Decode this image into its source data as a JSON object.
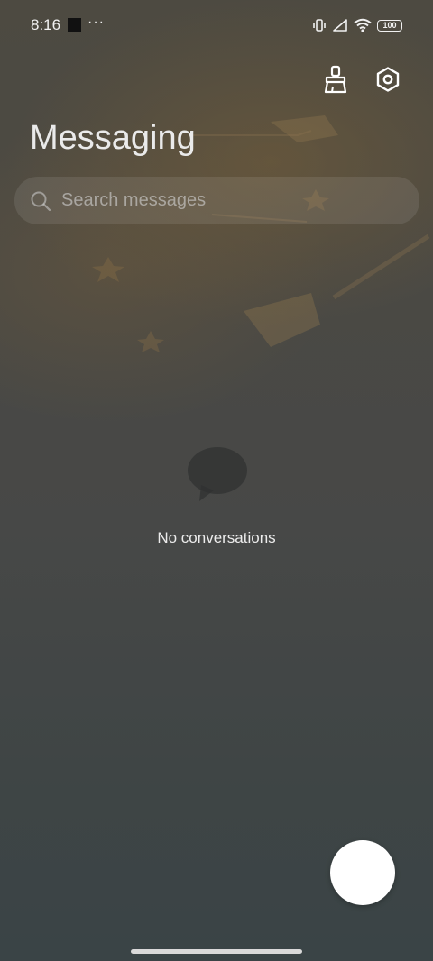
{
  "status_bar": {
    "time": "8:16",
    "more_indicator": "···",
    "battery_level": "100",
    "icons": [
      "notification-square-icon",
      "vibrate-icon",
      "cellular-signal-icon",
      "wifi-icon",
      "battery-icon"
    ]
  },
  "header": {
    "title": "Messaging",
    "actions": [
      {
        "name": "clean-icon"
      },
      {
        "name": "settings-icon"
      }
    ]
  },
  "search": {
    "placeholder": "Search messages",
    "value": ""
  },
  "empty_state": {
    "icon": "chat-bubble-icon",
    "text": "No conversations"
  },
  "fab": {
    "icon": "new-message-fab"
  },
  "colors": {
    "fab_background": "#ffffff",
    "text_primary": "#eaeaea"
  }
}
